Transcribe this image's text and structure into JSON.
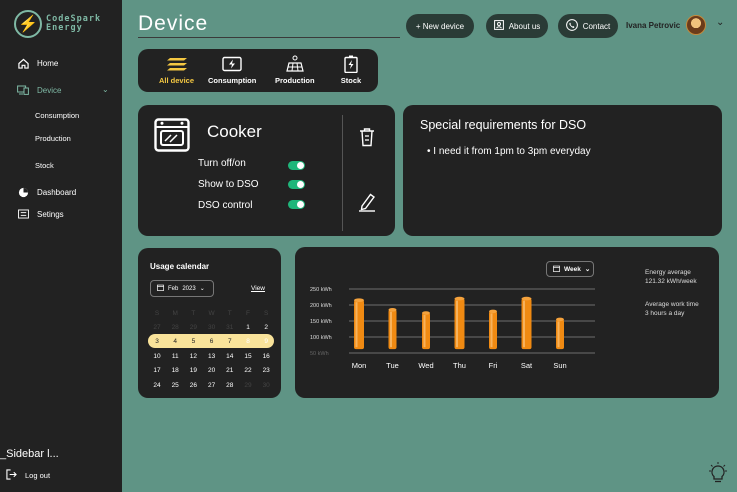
{
  "brand": {
    "line1": "CodeSpark",
    "line2": "Energy"
  },
  "sidebar": {
    "home": "Home",
    "device": "Device",
    "consumption": "Consumption",
    "production": "Production",
    "stock": "Stock",
    "dashboard": "Dashboard",
    "settings": "Setings",
    "caption": "_Sidebar l...",
    "logout": "Log out"
  },
  "header": {
    "title": "Device",
    "new_device": "+ New device",
    "about": "About us",
    "contact": "Contact",
    "user_name": "Ivana Petrovic"
  },
  "tabs": [
    "All device",
    "Consumption",
    "Production",
    "Stock"
  ],
  "device": {
    "name": "Cooker",
    "toggles": [
      "Turn off/on",
      "Show to DSO",
      "DSO control"
    ]
  },
  "requirements": {
    "title": "Special requirements for DSO",
    "item": "I need it from 1pm to 3pm everyday"
  },
  "calendar": {
    "title": "Usage calendar",
    "month": "Feb",
    "year": "2023",
    "view": "View",
    "weekdays": [
      "S",
      "M",
      "T",
      "W",
      "T",
      "F",
      "S"
    ],
    "rows": [
      [
        "27",
        "28",
        "29",
        "30",
        "31",
        "1",
        "2"
      ],
      [
        "3",
        "4",
        "5",
        "6",
        "7",
        "8",
        "9"
      ],
      [
        "10",
        "11",
        "12",
        "13",
        "14",
        "15",
        "16"
      ],
      [
        "17",
        "18",
        "19",
        "20",
        "21",
        "22",
        "23"
      ],
      [
        "24",
        "25",
        "26",
        "27",
        "28",
        "29",
        "30"
      ]
    ]
  },
  "usage": {
    "period": "Week",
    "energy_label": "Energy average",
    "energy_value": "121.32 kWh/week",
    "work_label": "Average work time",
    "work_value": "3 hours a day"
  },
  "chart_data": {
    "type": "bar",
    "categories": [
      "Mon",
      "Tue",
      "Wed",
      "Thu",
      "Fri",
      "Sat",
      "Sun"
    ],
    "values": [
      215,
      185,
      175,
      220,
      180,
      220,
      155
    ],
    "yticks": [
      "250 kWh",
      "200 kWh",
      "150 kWh",
      "100 kWh",
      "50 kWh"
    ],
    "ylim": [
      50,
      250
    ],
    "colors": {
      "bar": "#f08a12",
      "bar_top": "#f5a23c"
    }
  }
}
